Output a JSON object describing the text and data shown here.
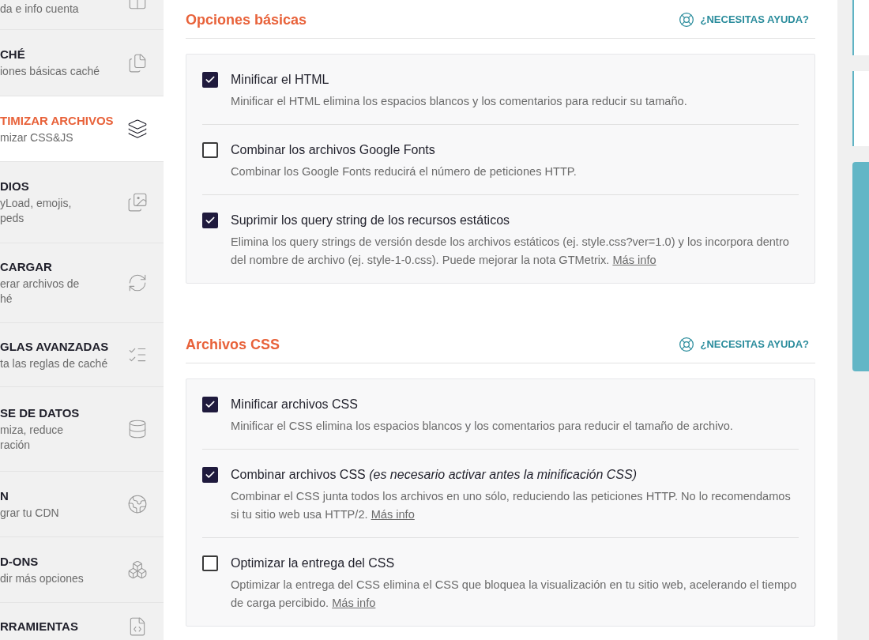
{
  "sidebar": {
    "items": [
      {
        "subtitle": "da e info cuenta",
        "selected": false
      },
      {
        "title": "CHÉ",
        "subtitle": "iones básicas caché",
        "selected": false
      },
      {
        "title": "TIMIZAR ARCHIVOS",
        "subtitle": "mizar CSS&JS",
        "selected": true
      },
      {
        "title": "DIOS",
        "subtitle": "yLoad, emojis,\npeds",
        "selected": false
      },
      {
        "title": "CARGAR",
        "subtitle": "erar archivos de\nhé",
        "selected": false
      },
      {
        "title": "GLAS AVANZADAS",
        "subtitle": "ta las reglas de caché",
        "selected": false
      },
      {
        "title": "SE DE DATOS",
        "subtitle": "miza, reduce\nración",
        "selected": false
      },
      {
        "title": "N",
        "subtitle": "grar tu CDN",
        "selected": false
      },
      {
        "title": "D-ONS",
        "subtitle": "dir más opciones",
        "selected": false
      },
      {
        "title": "RRAMIENTAS",
        "selected": false
      }
    ]
  },
  "sections": [
    {
      "title": "Opciones básicas",
      "help": "¿NECESITAS AYUDA?",
      "options": [
        {
          "label": "Minificar el HTML",
          "checked": true,
          "description": "Minificar el HTML elimina los espacios blancos y los comentarios para reducir su tamaño."
        },
        {
          "label": "Combinar los archivos Google Fonts",
          "checked": false,
          "description": "Combinar los Google Fonts reducirá el número de peticiones HTTP."
        },
        {
          "label": "Suprimir los query string de los recursos estáticos",
          "checked": true,
          "description": "Elimina los query strings de versión desde los archivos estáticos (ej. style.css?ver=1.0) y los incorpora dentro del nombre de archivo (ej. style-1-0.css). Puede mejorar la nota GTMetrix.",
          "link": "Más info"
        }
      ]
    },
    {
      "title": "Archivos CSS",
      "help": "¿NECESITAS AYUDA?",
      "options": [
        {
          "label": "Minificar archivos CSS",
          "checked": true,
          "description": "Minificar el CSS elimina los espacios blancos y los comentarios para reducir el tamaño de archivo."
        },
        {
          "label": "Combinar archivos CSS *(es necesario activar antes la minificación CSS)*",
          "checked": true,
          "description": "Combinar el CSS junta todos los archivos en uno sólo, reduciendo las peticiones HTTP. No lo recomendamos si tu sitio web usa HTTP/2.",
          "link": "Más info"
        },
        {
          "label": "Optimizar la entrega del CSS",
          "checked": false,
          "description": "Optimizar la entrega del CSS elimina el CSS que bloquea la visualización en tu sitio web, acelerando el tiempo de carga percibido.",
          "link": "Más info"
        }
      ]
    }
  ]
}
